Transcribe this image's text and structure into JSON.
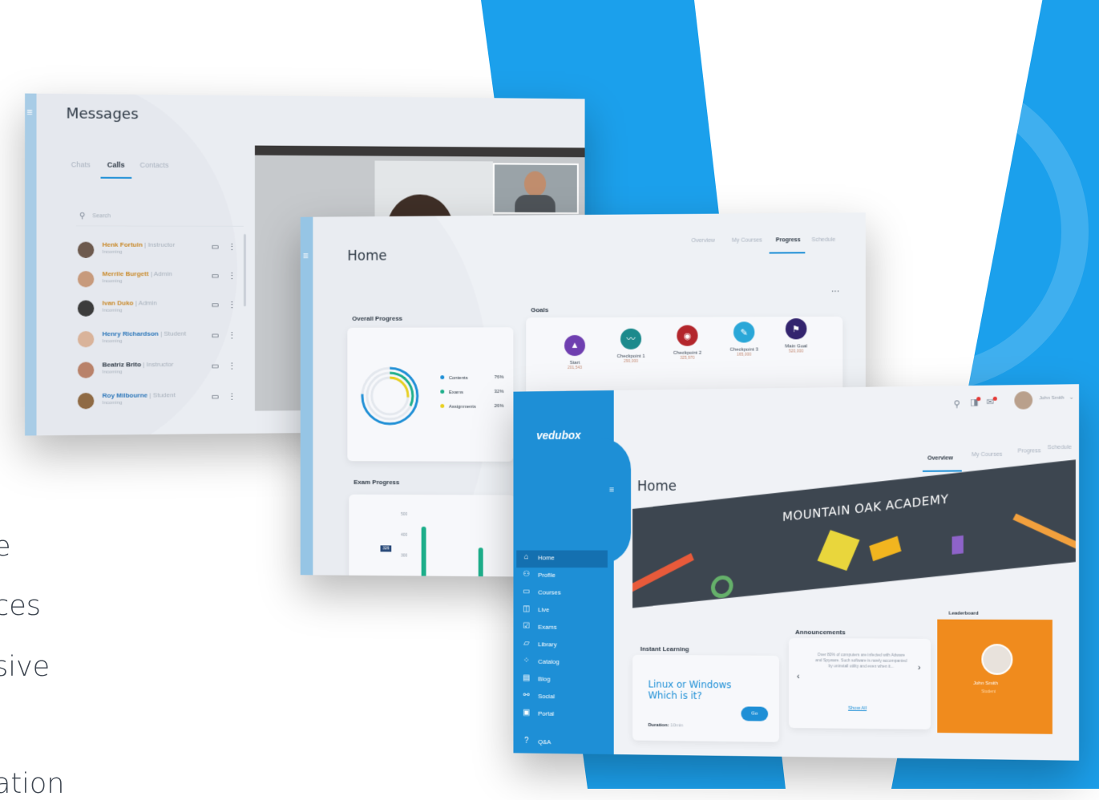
{
  "side_text": [
    "e",
    "ces",
    "sive",
    "ation"
  ],
  "messages_window": {
    "title": "Messages",
    "tabs": [
      "Chats",
      "Calls",
      "Contacts"
    ],
    "active_tab": "Calls",
    "search_placeholder": "Search",
    "calls": [
      {
        "name": "Henk Fortuin",
        "role": "| Instructor",
        "status": "Incoming"
      },
      {
        "name": "Merrile Burgett",
        "role": "| Admin",
        "status": "Incoming"
      },
      {
        "name": "Ivan Duko",
        "role": "| Admin",
        "status": "Incoming"
      },
      {
        "name": "Henry Richardson",
        "role": "| Student",
        "status": "Incoming"
      },
      {
        "name": "Beatriz Brito",
        "role": "| Instructor",
        "status": "Incoming"
      },
      {
        "name": "Roy Milbourne",
        "role": "| Student",
        "status": "Incoming"
      }
    ]
  },
  "progress_window": {
    "title": "Home",
    "tabs": [
      "Overview",
      "My Courses",
      "Progress",
      "Schedule"
    ],
    "active_tab": "Progress",
    "overall_title": "Overall Progress",
    "legend": [
      {
        "label": "Contents",
        "value": "76%",
        "color": "#1e8fd6",
        "fraction": 0.76
      },
      {
        "label": "Exams",
        "value": "32%",
        "color": "#1cae8a",
        "fraction": 0.32
      },
      {
        "label": "Assignments",
        "value": "26%",
        "color": "#e8cf1f",
        "fraction": 0.26
      }
    ],
    "goals_title": "Goals",
    "goals": [
      {
        "name": "Start",
        "points": "201,543",
        "color": "#6f3fb0",
        "icon": "rocket-icon"
      },
      {
        "name": "Checkpoint 1",
        "points": "290,000",
        "color": "#1c8a8c",
        "icon": "swimmer-icon"
      },
      {
        "name": "Checkpoint 2",
        "points": "325,970",
        "color": "#b3262c",
        "icon": "target-icon"
      },
      {
        "name": "Checkpoint 3",
        "points": "165,000",
        "color": "#2aa7d8",
        "icon": "pencil-icon"
      },
      {
        "name": "Main Goal",
        "points": "520,000",
        "color": "#33246e",
        "icon": "flag-icon"
      }
    ],
    "exam_title": "Exam Progress",
    "exam_ticks": [
      "500",
      "400",
      "300"
    ],
    "exam_badge": "326"
  },
  "home_window": {
    "logo": "vedubox",
    "title": "Home",
    "tabs": [
      "Overview",
      "My Courses",
      "Progress",
      "Schedule"
    ],
    "active_tab": "Overview",
    "user_name": "John Smith",
    "nav": [
      {
        "label": "Home",
        "icon": "home-icon"
      },
      {
        "label": "Profile",
        "icon": "profile-icon"
      },
      {
        "label": "Courses",
        "icon": "courses-icon"
      },
      {
        "label": "Live",
        "icon": "live-icon"
      },
      {
        "label": "Exams",
        "icon": "exams-icon"
      },
      {
        "label": "Library",
        "icon": "library-icon"
      },
      {
        "label": "Catalog",
        "icon": "catalog-icon"
      },
      {
        "label": "Blog",
        "icon": "blog-icon"
      },
      {
        "label": "Social",
        "icon": "social-icon"
      },
      {
        "label": "Portal",
        "icon": "portal-icon"
      },
      {
        "label": "Q&A",
        "icon": "help-icon"
      }
    ],
    "banner_title": "MOUNTAIN OAK ACADEMY",
    "instant_learning": {
      "title": "Instant Learning",
      "course": "Linux or Windows Which is it?",
      "duration_label": "Duration:",
      "duration_value": "10min",
      "button": "Go"
    },
    "announcements": {
      "title": "Announcements",
      "text": "Over 80% of computers are infected with Adware and Spyware. Such software is rarely accompanied by uninstall utility and even when it...",
      "link": "Show All"
    },
    "leaderboard": {
      "title": "Leaderboard",
      "name": "John Smith",
      "subtitle": "Student"
    }
  },
  "colors": {
    "brand_blue": "#1e8fd6",
    "background_blue": "#1ba0ec",
    "leaderboard_orange": "#f08b1d"
  }
}
